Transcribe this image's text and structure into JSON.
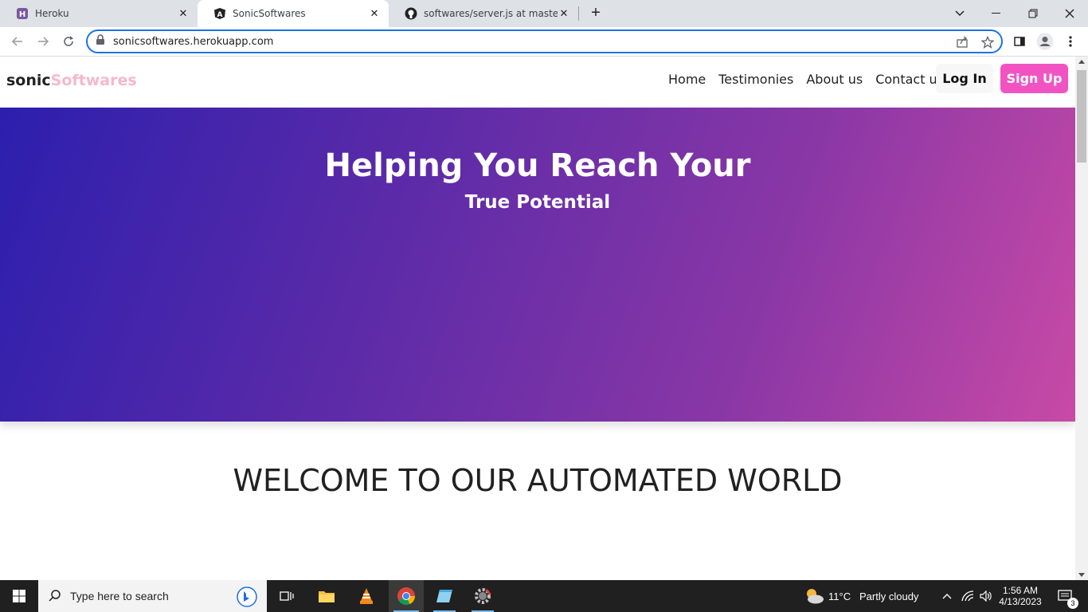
{
  "browser": {
    "tabs": [
      {
        "title": "Heroku",
        "favicon": "heroku-icon"
      },
      {
        "title": "SonicSoftwares",
        "favicon": "angular-icon"
      },
      {
        "title": "softwares/server.js at master · He",
        "favicon": "github-icon"
      }
    ],
    "url": "sonicsoftwares.herokuapp.com"
  },
  "site": {
    "logo_part1": "sonic",
    "logo_part2": "Softwares",
    "nav": [
      "Home",
      "Testimonies",
      "About us",
      "Contact us"
    ],
    "login_label": "Log In",
    "signup_label": "Sign Up",
    "hero_title": "Helping You Reach Your",
    "hero_subtitle": "True Potential",
    "welcome": "WELCOME TO OUR AUTOMATED WORLD"
  },
  "taskbar": {
    "search_placeholder": "Type here to search",
    "weather_temp": "11°C",
    "weather_desc": "Partly cloudy",
    "time": "1:56 AM",
    "date": "4/13/2023",
    "notification_count": "3"
  },
  "colors": {
    "accent": "#f154c2",
    "logo_secondary": "#f6b8c8",
    "hero_start": "#2c1fae",
    "hero_end": "#c84aa6"
  }
}
